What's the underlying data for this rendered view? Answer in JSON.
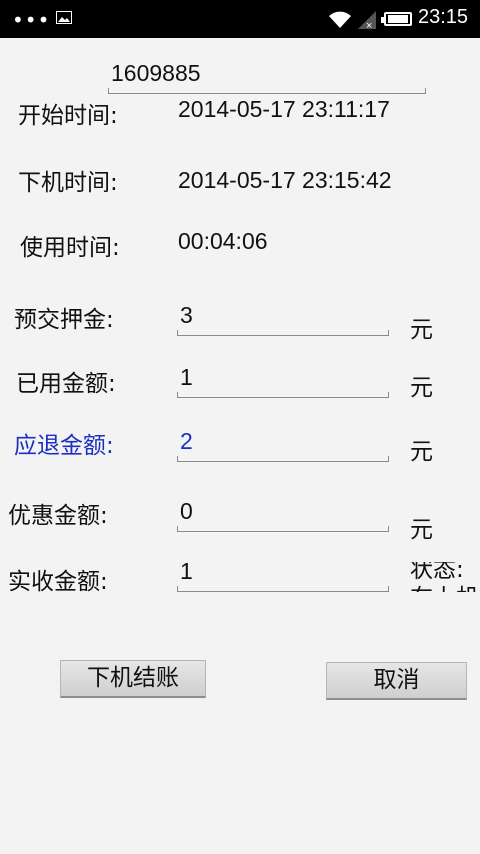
{
  "status_bar": {
    "overflow_icon": "overflow-dots-icon",
    "image_icon": "image-notification-icon",
    "wifi_icon": "wifi-icon",
    "signal_icon": "signal-no-service-icon",
    "battery_icon": "battery-icon",
    "battery_percent": 100,
    "time": "23:15"
  },
  "machine_id": "1609885",
  "rows": [
    {
      "label": "开始时间:",
      "value": "2014-05-17 23:11:17"
    },
    {
      "label": "下机时间:",
      "value": "2014-05-17 23:15:42"
    },
    {
      "label": "使用时间:",
      "value": "00:04:06"
    }
  ],
  "amounts": [
    {
      "label": "预交押金:",
      "value": "3",
      "unit": "元"
    },
    {
      "label": "已用金额:",
      "value": "1",
      "unit": "元"
    },
    {
      "label": "应退金额:",
      "value": "2",
      "unit": "元"
    },
    {
      "label": "优惠金额:",
      "value": "0",
      "unit": "元"
    },
    {
      "label": "实收金额:",
      "value": "1",
      "unit": ""
    }
  ],
  "status_clipped": {
    "line1": "状态:",
    "line2": "在上机"
  },
  "buttons": {
    "checkout": "下机结账",
    "cancel": "取消"
  },
  "colors": {
    "highlight_blue": "#1b2fc2",
    "background": "#f3f3f3"
  }
}
